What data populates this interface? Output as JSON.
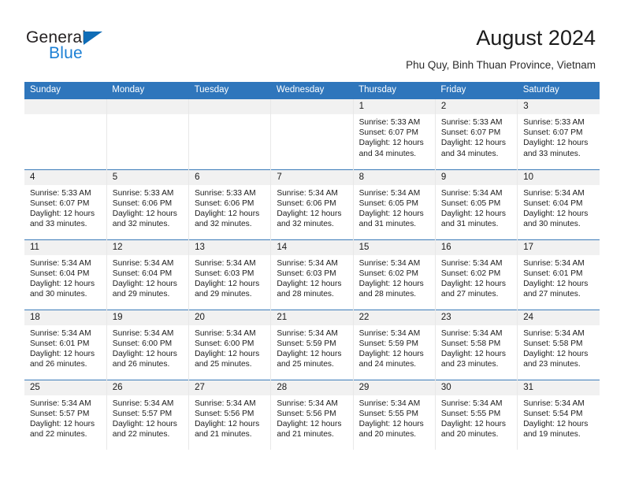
{
  "brand": {
    "name_part1": "General",
    "name_part2": "Blue",
    "triangle_color": "#0f6cb6",
    "blue_text_color": "#1b7fd4"
  },
  "header": {
    "title": "August 2024",
    "subtitle": "Phu Quy, Binh Thuan Province, Vietnam",
    "header_bg_color": "#2f76bc",
    "row_divider_color": "#3c7cb9",
    "daynum_band_color": "#f1f1f1"
  },
  "calendar": {
    "weekday_headers": [
      "Sunday",
      "Monday",
      "Tuesday",
      "Wednesday",
      "Thursday",
      "Friday",
      "Saturday"
    ],
    "weeks": [
      [
        {
          "day": "",
          "empty": true
        },
        {
          "day": "",
          "empty": true
        },
        {
          "day": "",
          "empty": true
        },
        {
          "day": "",
          "empty": true
        },
        {
          "day": "1",
          "sunrise": "Sunrise: 5:33 AM",
          "sunset": "Sunset: 6:07 PM",
          "daylight_line1": "Daylight: 12 hours",
          "daylight_line2": "and 34 minutes."
        },
        {
          "day": "2",
          "sunrise": "Sunrise: 5:33 AM",
          "sunset": "Sunset: 6:07 PM",
          "daylight_line1": "Daylight: 12 hours",
          "daylight_line2": "and 34 minutes."
        },
        {
          "day": "3",
          "sunrise": "Sunrise: 5:33 AM",
          "sunset": "Sunset: 6:07 PM",
          "daylight_line1": "Daylight: 12 hours",
          "daylight_line2": "and 33 minutes."
        }
      ],
      [
        {
          "day": "4",
          "sunrise": "Sunrise: 5:33 AM",
          "sunset": "Sunset: 6:07 PM",
          "daylight_line1": "Daylight: 12 hours",
          "daylight_line2": "and 33 minutes."
        },
        {
          "day": "5",
          "sunrise": "Sunrise: 5:33 AM",
          "sunset": "Sunset: 6:06 PM",
          "daylight_line1": "Daylight: 12 hours",
          "daylight_line2": "and 32 minutes."
        },
        {
          "day": "6",
          "sunrise": "Sunrise: 5:33 AM",
          "sunset": "Sunset: 6:06 PM",
          "daylight_line1": "Daylight: 12 hours",
          "daylight_line2": "and 32 minutes."
        },
        {
          "day": "7",
          "sunrise": "Sunrise: 5:34 AM",
          "sunset": "Sunset: 6:06 PM",
          "daylight_line1": "Daylight: 12 hours",
          "daylight_line2": "and 32 minutes."
        },
        {
          "day": "8",
          "sunrise": "Sunrise: 5:34 AM",
          "sunset": "Sunset: 6:05 PM",
          "daylight_line1": "Daylight: 12 hours",
          "daylight_line2": "and 31 minutes."
        },
        {
          "day": "9",
          "sunrise": "Sunrise: 5:34 AM",
          "sunset": "Sunset: 6:05 PM",
          "daylight_line1": "Daylight: 12 hours",
          "daylight_line2": "and 31 minutes."
        },
        {
          "day": "10",
          "sunrise": "Sunrise: 5:34 AM",
          "sunset": "Sunset: 6:04 PM",
          "daylight_line1": "Daylight: 12 hours",
          "daylight_line2": "and 30 minutes."
        }
      ],
      [
        {
          "day": "11",
          "sunrise": "Sunrise: 5:34 AM",
          "sunset": "Sunset: 6:04 PM",
          "daylight_line1": "Daylight: 12 hours",
          "daylight_line2": "and 30 minutes."
        },
        {
          "day": "12",
          "sunrise": "Sunrise: 5:34 AM",
          "sunset": "Sunset: 6:04 PM",
          "daylight_line1": "Daylight: 12 hours",
          "daylight_line2": "and 29 minutes."
        },
        {
          "day": "13",
          "sunrise": "Sunrise: 5:34 AM",
          "sunset": "Sunset: 6:03 PM",
          "daylight_line1": "Daylight: 12 hours",
          "daylight_line2": "and 29 minutes."
        },
        {
          "day": "14",
          "sunrise": "Sunrise: 5:34 AM",
          "sunset": "Sunset: 6:03 PM",
          "daylight_line1": "Daylight: 12 hours",
          "daylight_line2": "and 28 minutes."
        },
        {
          "day": "15",
          "sunrise": "Sunrise: 5:34 AM",
          "sunset": "Sunset: 6:02 PM",
          "daylight_line1": "Daylight: 12 hours",
          "daylight_line2": "and 28 minutes."
        },
        {
          "day": "16",
          "sunrise": "Sunrise: 5:34 AM",
          "sunset": "Sunset: 6:02 PM",
          "daylight_line1": "Daylight: 12 hours",
          "daylight_line2": "and 27 minutes."
        },
        {
          "day": "17",
          "sunrise": "Sunrise: 5:34 AM",
          "sunset": "Sunset: 6:01 PM",
          "daylight_line1": "Daylight: 12 hours",
          "daylight_line2": "and 27 minutes."
        }
      ],
      [
        {
          "day": "18",
          "sunrise": "Sunrise: 5:34 AM",
          "sunset": "Sunset: 6:01 PM",
          "daylight_line1": "Daylight: 12 hours",
          "daylight_line2": "and 26 minutes."
        },
        {
          "day": "19",
          "sunrise": "Sunrise: 5:34 AM",
          "sunset": "Sunset: 6:00 PM",
          "daylight_line1": "Daylight: 12 hours",
          "daylight_line2": "and 26 minutes."
        },
        {
          "day": "20",
          "sunrise": "Sunrise: 5:34 AM",
          "sunset": "Sunset: 6:00 PM",
          "daylight_line1": "Daylight: 12 hours",
          "daylight_line2": "and 25 minutes."
        },
        {
          "day": "21",
          "sunrise": "Sunrise: 5:34 AM",
          "sunset": "Sunset: 5:59 PM",
          "daylight_line1": "Daylight: 12 hours",
          "daylight_line2": "and 25 minutes."
        },
        {
          "day": "22",
          "sunrise": "Sunrise: 5:34 AM",
          "sunset": "Sunset: 5:59 PM",
          "daylight_line1": "Daylight: 12 hours",
          "daylight_line2": "and 24 minutes."
        },
        {
          "day": "23",
          "sunrise": "Sunrise: 5:34 AM",
          "sunset": "Sunset: 5:58 PM",
          "daylight_line1": "Daylight: 12 hours",
          "daylight_line2": "and 23 minutes."
        },
        {
          "day": "24",
          "sunrise": "Sunrise: 5:34 AM",
          "sunset": "Sunset: 5:58 PM",
          "daylight_line1": "Daylight: 12 hours",
          "daylight_line2": "and 23 minutes."
        }
      ],
      [
        {
          "day": "25",
          "sunrise": "Sunrise: 5:34 AM",
          "sunset": "Sunset: 5:57 PM",
          "daylight_line1": "Daylight: 12 hours",
          "daylight_line2": "and 22 minutes."
        },
        {
          "day": "26",
          "sunrise": "Sunrise: 5:34 AM",
          "sunset": "Sunset: 5:57 PM",
          "daylight_line1": "Daylight: 12 hours",
          "daylight_line2": "and 22 minutes."
        },
        {
          "day": "27",
          "sunrise": "Sunrise: 5:34 AM",
          "sunset": "Sunset: 5:56 PM",
          "daylight_line1": "Daylight: 12 hours",
          "daylight_line2": "and 21 minutes."
        },
        {
          "day": "28",
          "sunrise": "Sunrise: 5:34 AM",
          "sunset": "Sunset: 5:56 PM",
          "daylight_line1": "Daylight: 12 hours",
          "daylight_line2": "and 21 minutes."
        },
        {
          "day": "29",
          "sunrise": "Sunrise: 5:34 AM",
          "sunset": "Sunset: 5:55 PM",
          "daylight_line1": "Daylight: 12 hours",
          "daylight_line2": "and 20 minutes."
        },
        {
          "day": "30",
          "sunrise": "Sunrise: 5:34 AM",
          "sunset": "Sunset: 5:55 PM",
          "daylight_line1": "Daylight: 12 hours",
          "daylight_line2": "and 20 minutes."
        },
        {
          "day": "31",
          "sunrise": "Sunrise: 5:34 AM",
          "sunset": "Sunset: 5:54 PM",
          "daylight_line1": "Daylight: 12 hours",
          "daylight_line2": "and 19 minutes."
        }
      ]
    ]
  }
}
